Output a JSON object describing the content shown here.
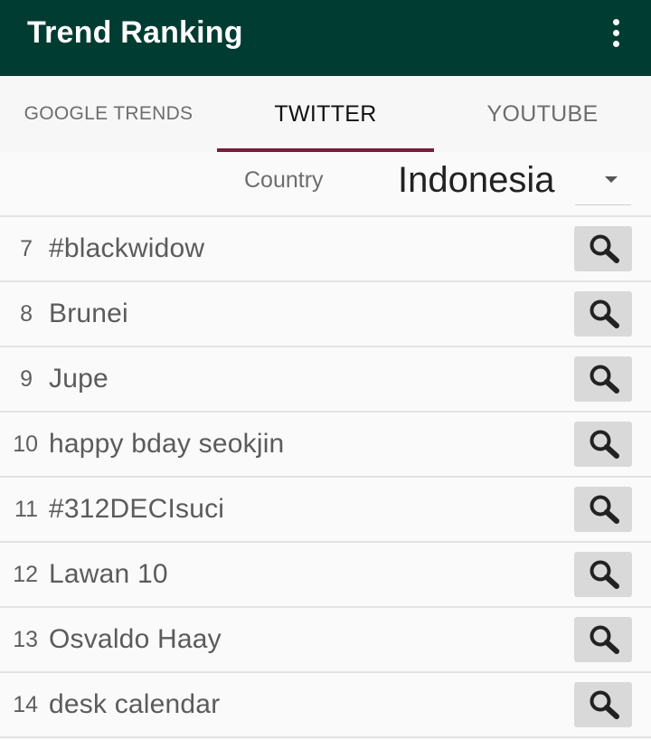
{
  "app": {
    "title": "Trend Ranking",
    "menu_icon": "more-vert-icon"
  },
  "tabs": [
    {
      "label": "GOOGLE TRENDS",
      "active": false
    },
    {
      "label": "TWITTER",
      "active": true
    },
    {
      "label": "YOUTUBE",
      "active": false
    }
  ],
  "filter": {
    "label": "Country",
    "value": "Indonesia"
  },
  "colors": {
    "appbar": "#003c32",
    "tab_indicator": "#7a1c3c",
    "search_button": "#d9d9d9"
  },
  "trends": [
    {
      "rank": "7",
      "term": "#blackwidow"
    },
    {
      "rank": "8",
      "term": "Brunei"
    },
    {
      "rank": "9",
      "term": "Jupe"
    },
    {
      "rank": "10",
      "term": "happy bday seokjin"
    },
    {
      "rank": "11",
      "term": "#312DECIsuci"
    },
    {
      "rank": "12",
      "term": "Lawan 10"
    },
    {
      "rank": "13",
      "term": "Osvaldo Haay"
    },
    {
      "rank": "14",
      "term": "desk calendar"
    }
  ]
}
